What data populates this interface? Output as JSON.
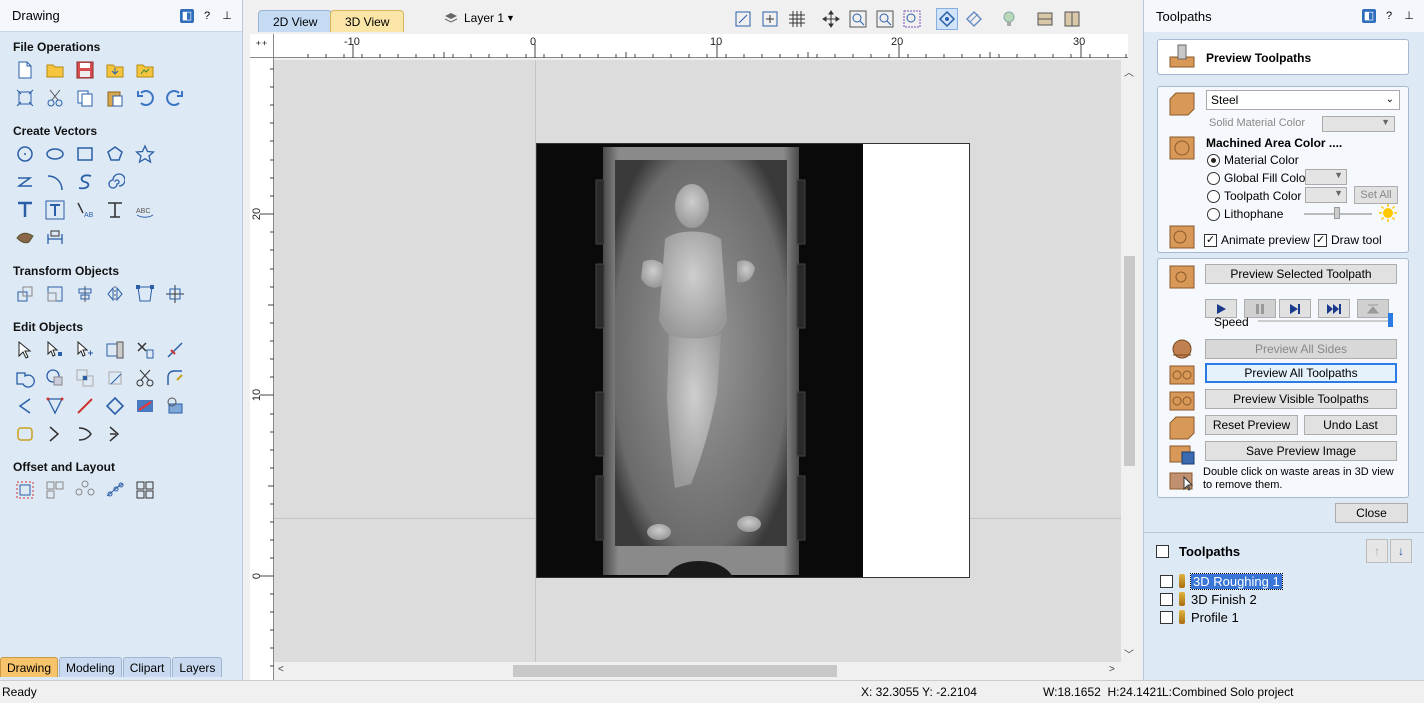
{
  "left_panel": {
    "title": "Drawing",
    "sections": {
      "file_operations": "File Operations",
      "create_vectors": "Create Vectors",
      "transform_objects": "Transform Objects",
      "edit_objects": "Edit Objects",
      "offset_layout": "Offset and Layout"
    },
    "tabs": [
      "Drawing",
      "Modeling",
      "Clipart",
      "Layers"
    ]
  },
  "view": {
    "tab_2d": "2D View",
    "tab_3d": "3D View",
    "layer": "Layer 1"
  },
  "ruler": {
    "top_labels": [
      "-10",
      "0",
      "10",
      "20",
      "30"
    ],
    "left_labels": [
      "20",
      "10",
      "0"
    ]
  },
  "right_panel": {
    "title": "Toolpaths",
    "preview_title": "Preview Toolpaths",
    "material": "Steel",
    "solid_material_color": "Solid Material Color",
    "machined_area_color": "Machined Area Color ....",
    "radio_options": [
      "Material Color",
      "Global Fill Color",
      "Toolpath Color",
      "Lithophane"
    ],
    "set_all": "Set All",
    "animate_preview": "Animate preview",
    "draw_tool": "Draw tool",
    "preview_selected": "Preview Selected Toolpath",
    "speed": "Speed",
    "preview_all_sides": "Preview All Sides",
    "preview_all_toolpaths": "Preview All Toolpaths",
    "preview_visible": "Preview Visible Toolpaths",
    "reset_preview": "Reset Preview",
    "undo_last": "Undo Last",
    "save_preview_image": "Save Preview Image",
    "hint": "Double click on waste areas in 3D view to remove them.",
    "close": "Close",
    "toolpaths_header": "Toolpaths",
    "toolpaths": [
      "3D Roughing 1",
      "3D Finish 2",
      "Profile 1"
    ]
  },
  "status": {
    "ready": "Ready",
    "coords": "X: 32.3055 Y: -2.2104",
    "size": "W:18.1652  H:24.1421",
    "project": "L:Combined Solo project"
  },
  "colors": {
    "panel_bg": "#dde9f5",
    "accent": "#2c7be5",
    "tab_active": "#f7c36b"
  }
}
